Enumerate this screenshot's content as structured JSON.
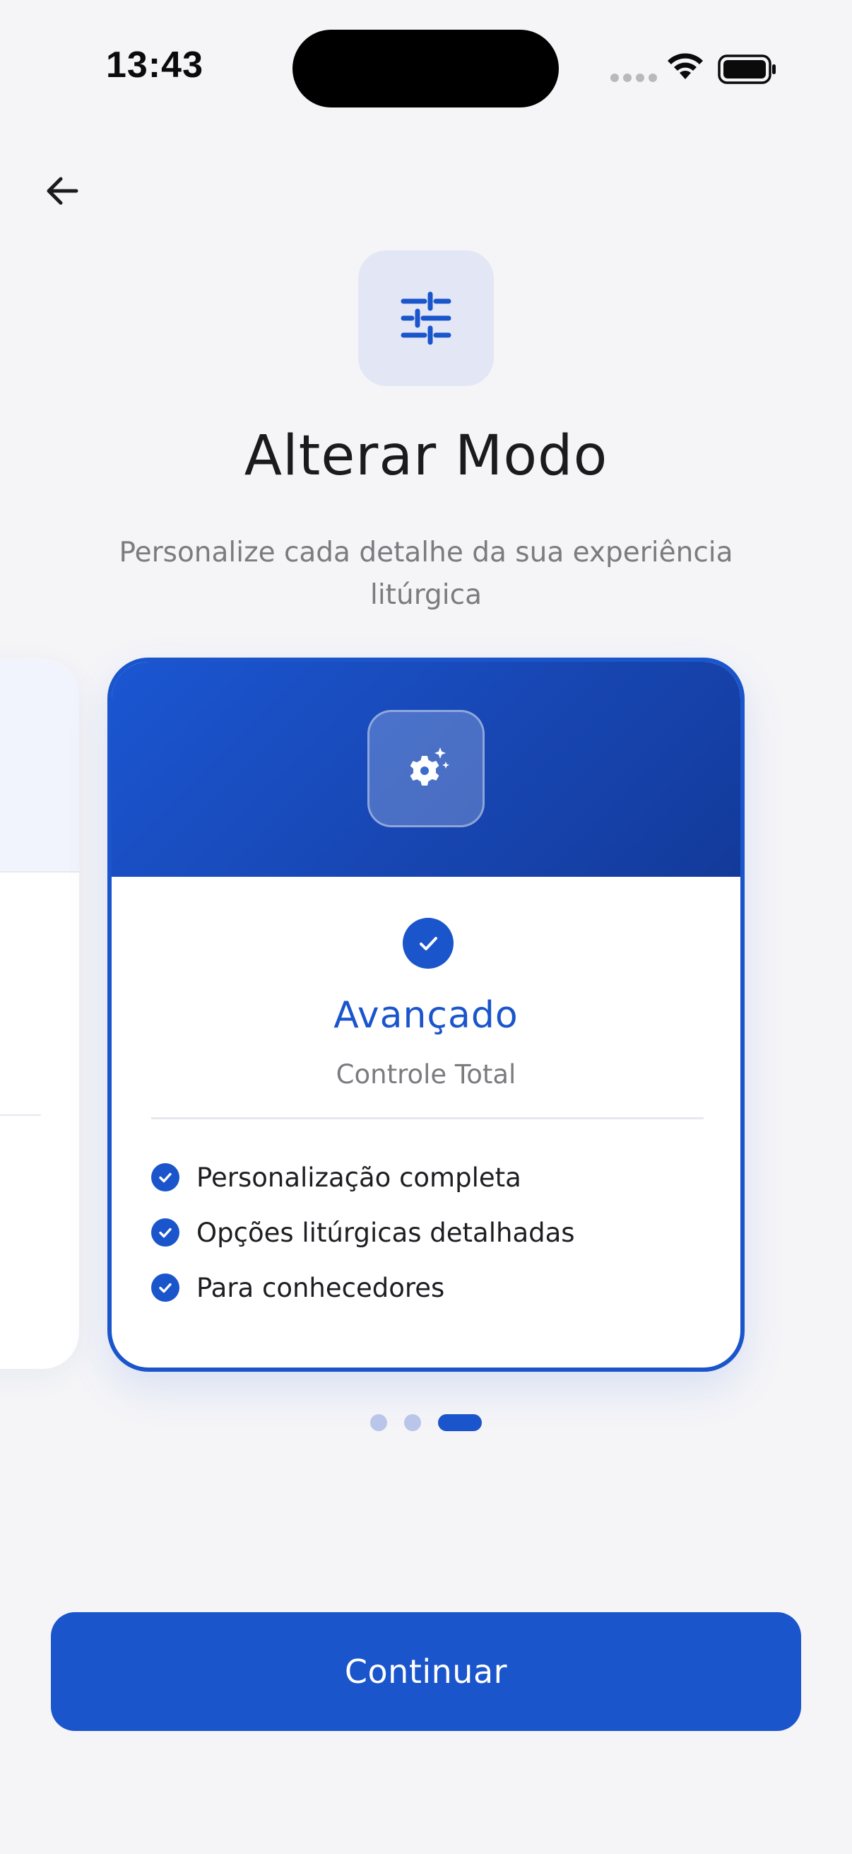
{
  "status_bar": {
    "time": "13:43"
  },
  "header": {
    "title": "Alterar Modo",
    "subtitle": "Personalize cada detalhe da sua experiência litúrgica",
    "icon": "sliders-icon"
  },
  "selected_card": {
    "icon": "gear-sparkle-icon",
    "title": "Avançado",
    "subtitle": "Controle Total",
    "selected": true,
    "features": [
      "Personalização completa",
      "Opções litúrgicas detalhadas",
      "Para conhecedores"
    ]
  },
  "pagination": {
    "total": 3,
    "current": 3
  },
  "actions": {
    "continue_label": "Continuar"
  },
  "colors": {
    "accent": "#1a55cc",
    "background": "#f5f5f8",
    "title_text": "#1b1b1f",
    "muted_text": "#7b7b80"
  }
}
